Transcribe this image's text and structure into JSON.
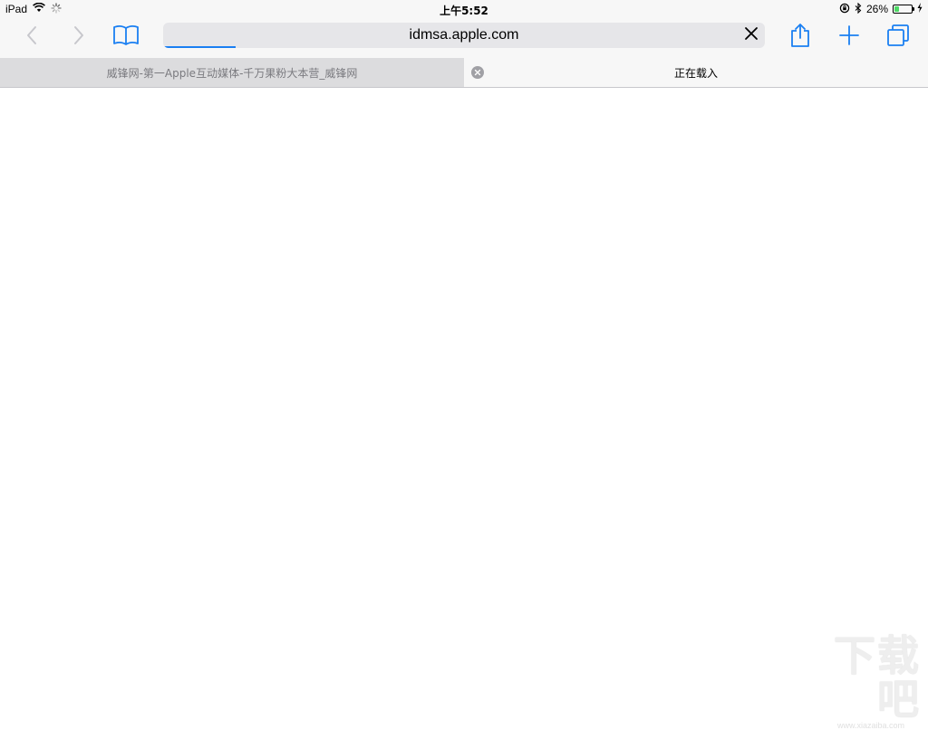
{
  "status_bar": {
    "device": "iPad",
    "time": "上午5:52",
    "battery_percent": "26%",
    "battery_level": 0.26,
    "icons": [
      "wifi-icon",
      "activity-spinner-icon",
      "orientation-lock-icon",
      "bluetooth-icon",
      "battery-icon",
      "charging-bolt-icon"
    ]
  },
  "toolbar": {
    "address_text": "idmsa.apple.com",
    "load_progress": 0.12,
    "icons": [
      "back-chevron-icon",
      "forward-chevron-icon",
      "bookmarks-book-icon",
      "clear-x-icon",
      "share-icon",
      "plus-icon",
      "tabs-overview-icon"
    ]
  },
  "tabs": [
    {
      "title": "威锋网-第一Apple互动媒体-千万果粉大本营_威锋网",
      "active": false
    },
    {
      "title": "正在载入",
      "active": true
    }
  ],
  "watermark": {
    "logo": "下载吧",
    "url": "www.xiazaiba.com"
  },
  "colors": {
    "accent": "#1a7ff2",
    "toolbar_bg": "#f7f7f7",
    "address_bg": "#e6e6e9",
    "tab_strip_bg": "#e1e1e3",
    "battery_fill": "#4cd964"
  }
}
